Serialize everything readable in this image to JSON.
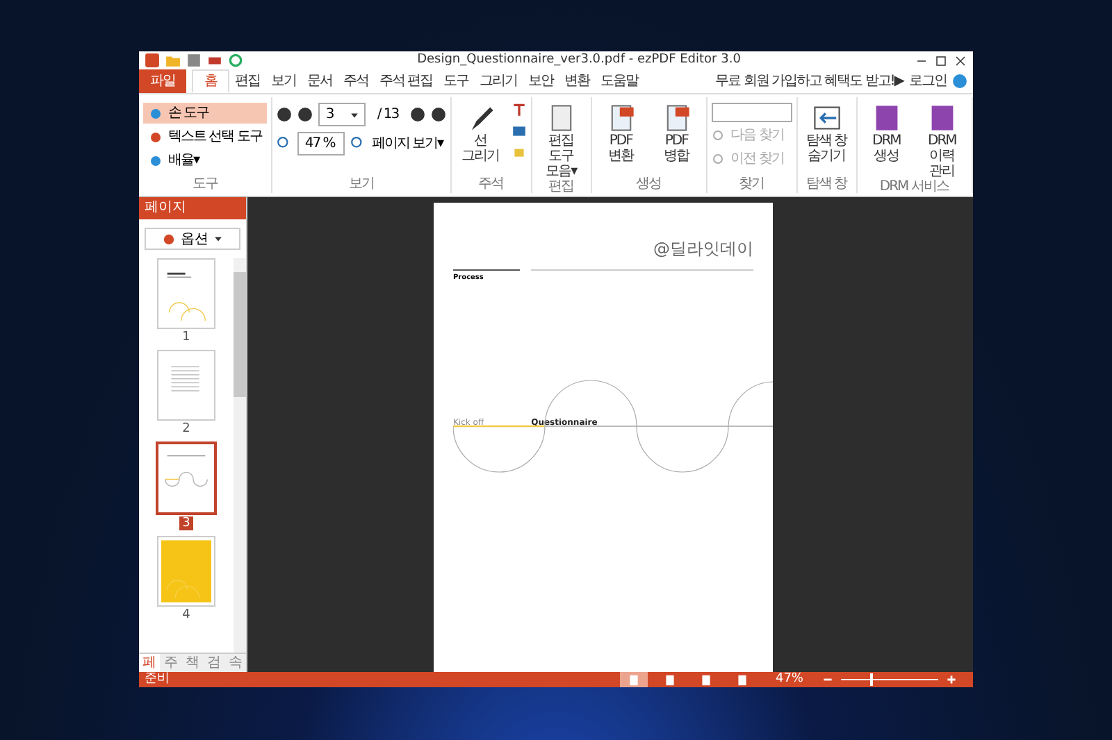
{
  "window": {
    "title": "Design_Questionnaire_ver3.0.pdf - ezPDF Editor 3.0"
  },
  "menu_tabs": [
    {
      "label": "파일",
      "kind": "file",
      "selected": false
    },
    {
      "label": "홈",
      "kind": "tab",
      "selected": true
    },
    {
      "label": "편집",
      "kind": "tab",
      "selected": false
    },
    {
      "label": "보기",
      "kind": "tab",
      "selected": false
    },
    {
      "label": "문서",
      "kind": "tab",
      "selected": false
    },
    {
      "label": "주석",
      "kind": "tab",
      "selected": false
    },
    {
      "label": "주석 편집",
      "kind": "tab",
      "selected": false
    },
    {
      "label": "도구",
      "kind": "tab",
      "selected": false
    },
    {
      "label": "그리기",
      "kind": "tab",
      "selected": false
    },
    {
      "label": "보안",
      "kind": "tab",
      "selected": false
    },
    {
      "label": "변환",
      "kind": "tab",
      "selected": false
    },
    {
      "label": "도움말",
      "kind": "tab",
      "selected": false
    }
  ],
  "promo": "무료 회원 가입하고 혜택도 받고!▶",
  "login": "로그인",
  "ribbon": {
    "tools": {
      "label": "도구",
      "items": [
        {
          "label": "손 도구",
          "selected": true
        },
        {
          "label": "텍스트 선택 도구",
          "selected": false
        },
        {
          "label": "배율▾",
          "selected": false
        }
      ]
    },
    "view": {
      "label": "보기",
      "page": "3",
      "total": "/ 13",
      "zoom": "47 %",
      "page_view": "페이지 보기▾"
    },
    "annotate": {
      "label": "주석",
      "draw": "선 그리기"
    },
    "edit": {
      "label": "편집",
      "toolbar": "편집 도구 모음▾"
    },
    "create": {
      "label": "생성",
      "items": [
        "PDF 변환",
        "PDF 병합"
      ]
    },
    "find": {
      "label": "찾기",
      "items": [
        {
          "label": "다음 찾기",
          "disabled": true
        },
        {
          "label": "이전 찾기",
          "disabled": true
        }
      ]
    },
    "nav": {
      "label": "탐색 창",
      "hide": "탐색 창 숨기기"
    },
    "drm": {
      "label": "DRM 서비스",
      "items": [
        "DRM 생성",
        "DRM 이력 관리"
      ]
    }
  },
  "sidebar": {
    "title": "페이지",
    "options": "옵션",
    "thumbnails": [
      {
        "number": "1",
        "kind": "cover",
        "selected": false
      },
      {
        "number": "2",
        "kind": "text",
        "selected": false
      },
      {
        "number": "3",
        "kind": "wave",
        "selected": true
      },
      {
        "number": "4",
        "kind": "yellow",
        "selected": false
      }
    ],
    "tabs": [
      {
        "label": "페",
        "selected": true
      },
      {
        "label": "주",
        "selected": false
      },
      {
        "label": "책",
        "selected": false
      },
      {
        "label": "검",
        "selected": false
      },
      {
        "label": "속",
        "selected": false
      }
    ]
  },
  "document": {
    "brand": "@딜라잇데이",
    "heading": "Process",
    "stages": [
      "Kick off",
      "Questionnaire"
    ]
  },
  "status_bar": {
    "text": "준비",
    "zoom": "47%",
    "level": 0.3,
    "views": [
      {
        "selected": true
      },
      {
        "selected": false
      },
      {
        "selected": false
      },
      {
        "selected": false
      }
    ]
  }
}
